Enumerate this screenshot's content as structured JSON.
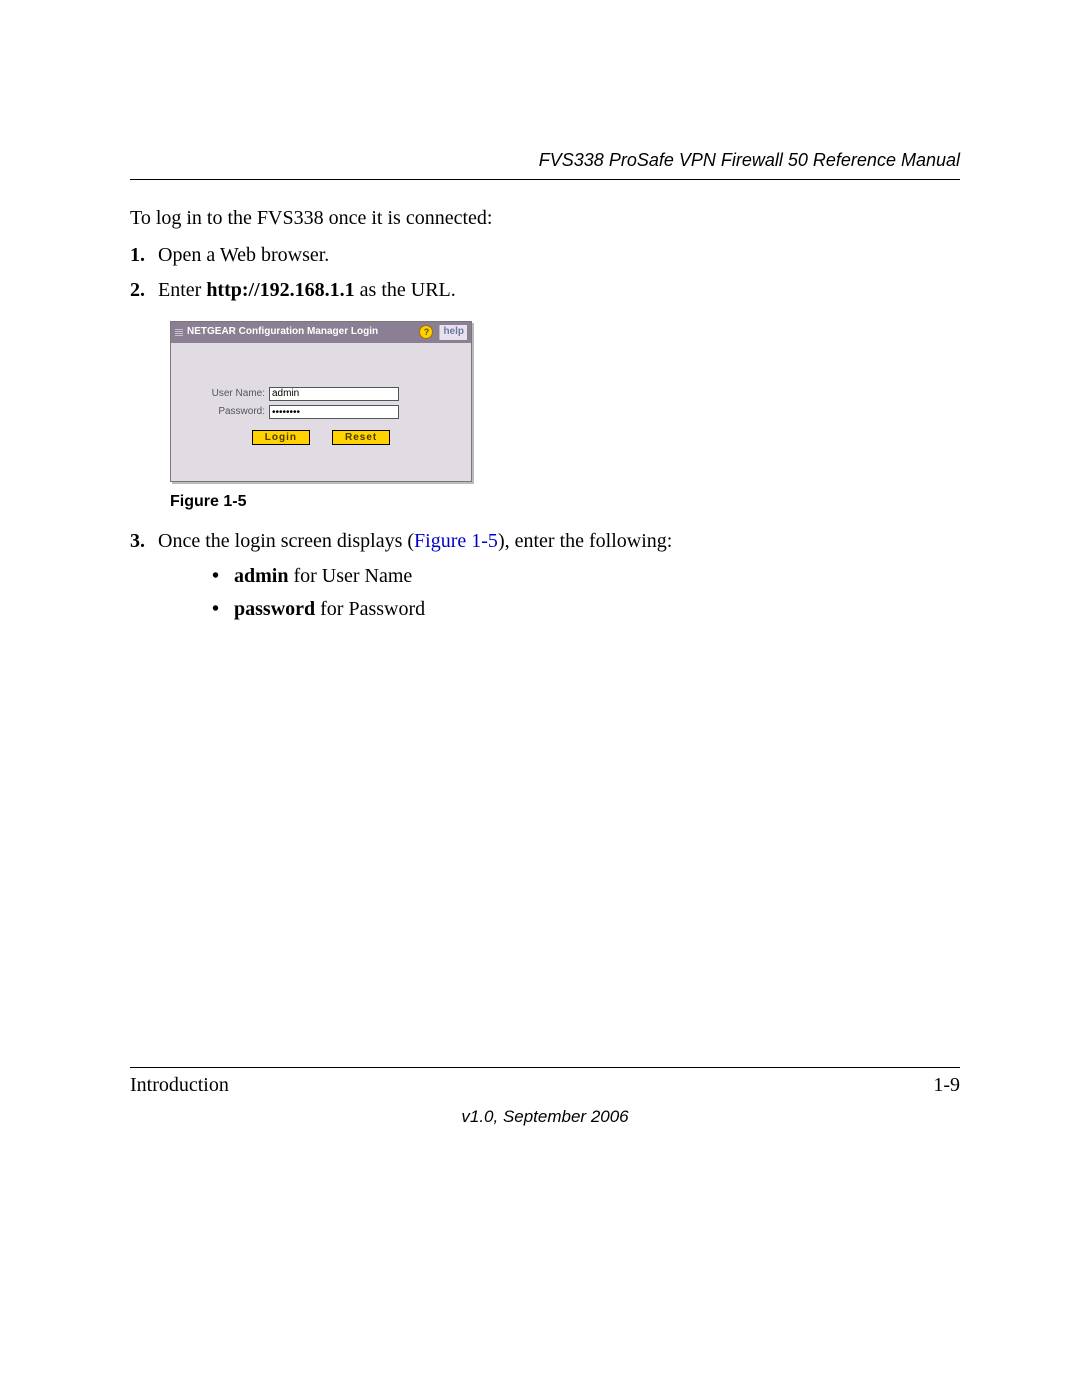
{
  "header": {
    "title": "FVS338 ProSafe VPN Firewall 50 Reference Manual"
  },
  "intro": "To log in to the FVS338 once it is connected:",
  "steps": {
    "s1": {
      "num": "1.",
      "text": "Open a Web browser."
    },
    "s2": {
      "num": "2.",
      "pre": "Enter ",
      "bold": "http://192.168.1.1",
      "post": " as the URL."
    },
    "s3": {
      "num": "3.",
      "pre": "Once the login screen displays (",
      "ref": "Figure 1-5",
      "post": "), enter the following:"
    }
  },
  "bullets": {
    "b1": {
      "bold": "admin",
      "rest": " for User Name"
    },
    "b2": {
      "bold": "password",
      "rest": " for Password"
    }
  },
  "figure_caption": "Figure 1-5",
  "screenshot": {
    "title": "NETGEAR Configuration Manager Login",
    "help_label": "help",
    "username_label": "User Name:",
    "username_value": "admin",
    "password_label": "Password:",
    "password_value": "••••••••",
    "login_btn": "Login",
    "reset_btn": "Reset"
  },
  "footer": {
    "section": "Introduction",
    "page": "1-9",
    "version": "v1.0, September 2006"
  }
}
